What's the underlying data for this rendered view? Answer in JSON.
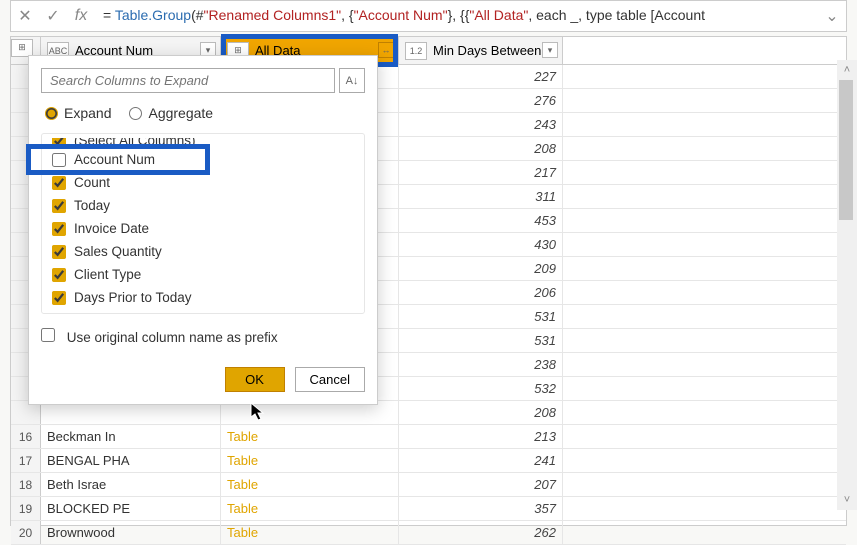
{
  "formula": {
    "prefix": "= ",
    "fn": "Table.Group",
    "open": "(#",
    "arg1": "\"Renamed Columns1\"",
    "mid1": ", {",
    "arg2": "\"Account Num\"",
    "mid2": "}, {{",
    "arg3": "\"All Data\"",
    "mid3": ", each _, type table [Account"
  },
  "columns": {
    "col1": {
      "label": "Account Num",
      "type": "ABC"
    },
    "col2": {
      "label": "All Data",
      "type": "⊞"
    },
    "col3": {
      "label": "Min Days Between",
      "type": "1.2"
    }
  },
  "popup": {
    "search_placeholder": "Search Columns to Expand",
    "radio_expand": "Expand",
    "radio_aggregate": "Aggregate",
    "select_all": "(Select All Columns)",
    "items": [
      {
        "label": "Account Num",
        "checked": false,
        "highlight": true
      },
      {
        "label": "Count",
        "checked": true
      },
      {
        "label": "Today",
        "checked": true
      },
      {
        "label": "Invoice Date",
        "checked": true
      },
      {
        "label": "Sales Quantity",
        "checked": true
      },
      {
        "label": "Client Type",
        "checked": true
      },
      {
        "label": "Days Prior to Today",
        "checked": true
      }
    ],
    "prefix_label": "Use original column name as prefix",
    "ok": "OK",
    "cancel": "Cancel"
  },
  "rows": [
    {
      "n": "",
      "c1": "",
      "c2": "",
      "c3": "227"
    },
    {
      "n": "",
      "c1": "",
      "c2": "",
      "c3": "276"
    },
    {
      "n": "",
      "c1": "",
      "c2": "",
      "c3": "243"
    },
    {
      "n": "",
      "c1": "",
      "c2": "",
      "c3": "208"
    },
    {
      "n": "",
      "c1": "",
      "c2": "",
      "c3": "217"
    },
    {
      "n": "",
      "c1": "",
      "c2": "",
      "c3": "311"
    },
    {
      "n": "",
      "c1": "",
      "c2": "",
      "c3": "453"
    },
    {
      "n": "",
      "c1": "",
      "c2": "",
      "c3": "430"
    },
    {
      "n": "",
      "c1": "",
      "c2": "",
      "c3": "209"
    },
    {
      "n": "",
      "c1": "",
      "c2": "",
      "c3": "206"
    },
    {
      "n": "",
      "c1": "",
      "c2": "",
      "c3": "531"
    },
    {
      "n": "",
      "c1": "",
      "c2": "",
      "c3": "531"
    },
    {
      "n": "",
      "c1": "",
      "c2": "",
      "c3": "238"
    },
    {
      "n": "",
      "c1": "",
      "c2": "",
      "c3": "532"
    },
    {
      "n": "",
      "c1": "",
      "c2": "",
      "c3": "208"
    },
    {
      "n": "16",
      "c1": "Beckman In",
      "c2": "Table",
      "c3": "213"
    },
    {
      "n": "17",
      "c1": "BENGAL PHA",
      "c2": "Table",
      "c3": "241"
    },
    {
      "n": "18",
      "c1": "Beth Israe",
      "c2": "Table",
      "c3": "207"
    },
    {
      "n": "19",
      "c1": "BLOCKED PE",
      "c2": "Table",
      "c3": "357"
    },
    {
      "n": "20",
      "c1": "Brownwood",
      "c2": "Table",
      "c3": "262"
    }
  ]
}
